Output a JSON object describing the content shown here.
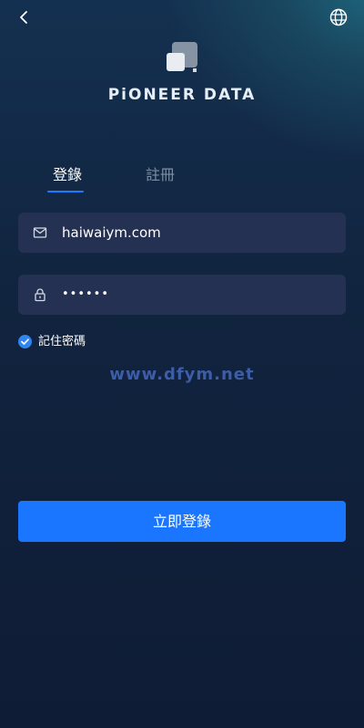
{
  "header": {
    "back_icon": "chevron-left-icon",
    "language_icon": "globe-icon"
  },
  "brand": {
    "name": "PiONEER DATA"
  },
  "tabs": [
    {
      "label": "登錄",
      "active": true
    },
    {
      "label": "註冊",
      "active": false
    }
  ],
  "form": {
    "email": {
      "value": "haiwaiym.com",
      "icon": "mail-icon"
    },
    "password": {
      "value": "••••••",
      "icon": "lock-icon"
    },
    "remember": {
      "label": "記住密碼",
      "checked": true
    },
    "submit_label": "立即登錄"
  },
  "watermark": "www.dfym.net",
  "colors": {
    "accent": "#1a75ff",
    "field_bg": "#253152",
    "inactive_tab": "#7f8ea3"
  }
}
